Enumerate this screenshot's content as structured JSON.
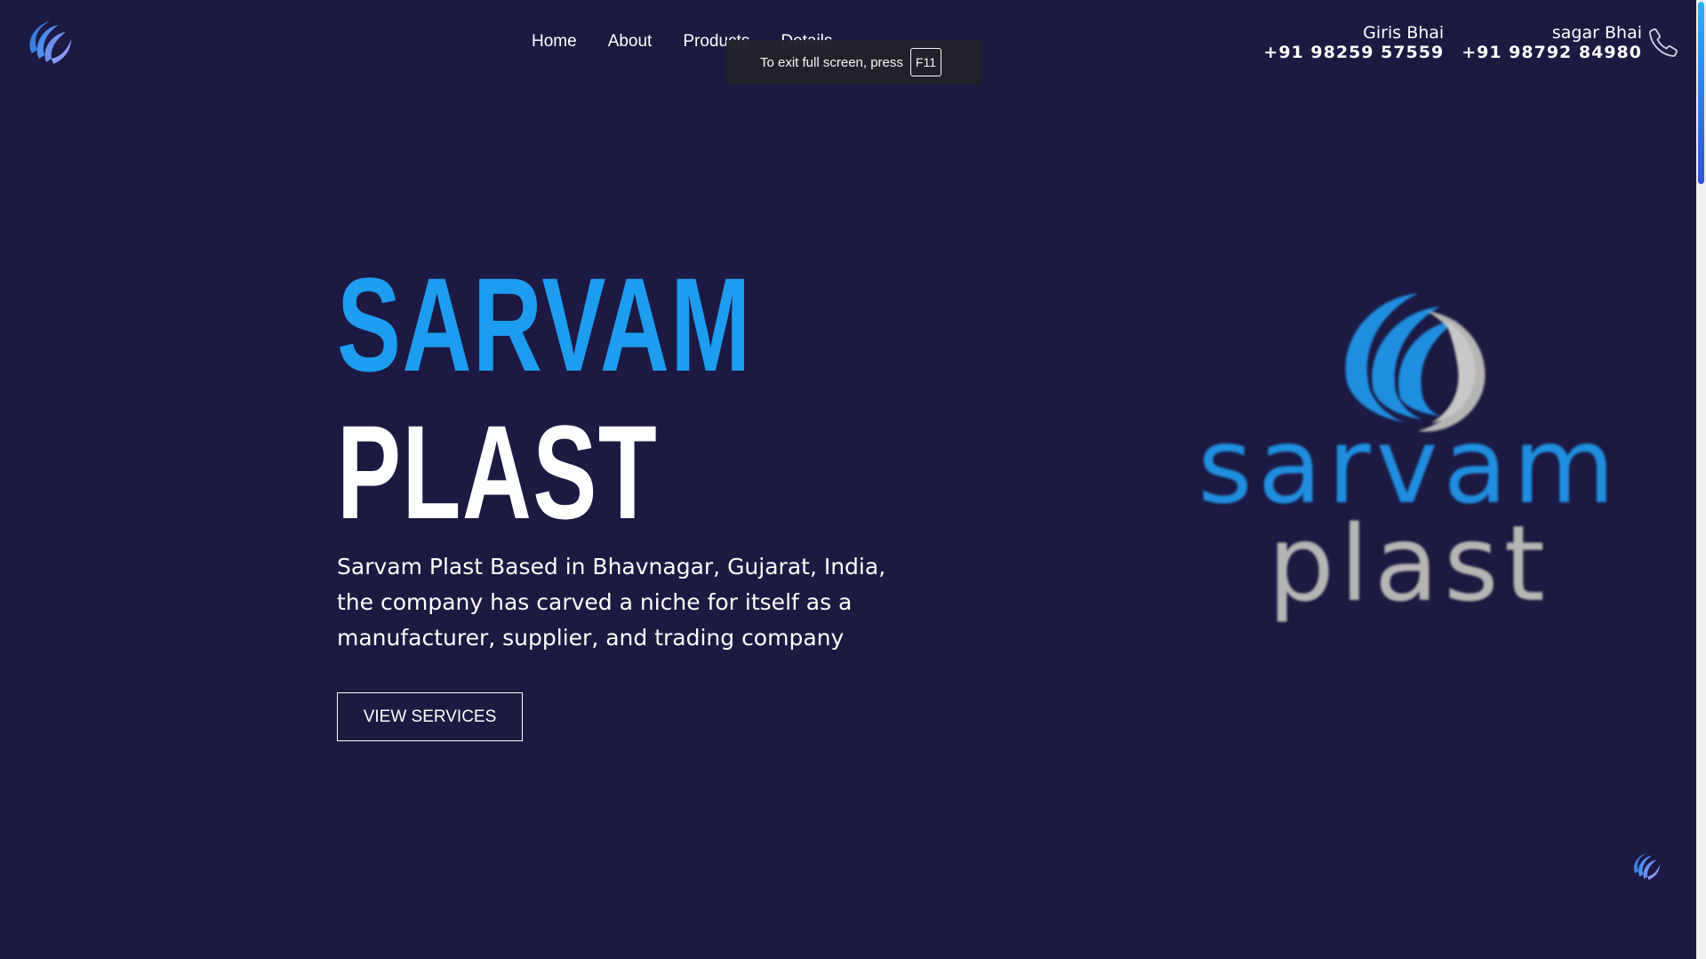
{
  "nav": {
    "items": [
      "Home",
      "About",
      "Products",
      "Details"
    ]
  },
  "contacts": [
    {
      "name": "Giris Bhai",
      "phone": "+91 98259 57559"
    },
    {
      "name": "sagar Bhai",
      "phone": "+91 98792 84980"
    }
  ],
  "fullscreen_notice": {
    "text": "To exit full screen, press",
    "key": "F11"
  },
  "hero": {
    "title_line1": "SARVAM",
    "title_line2": "PLAST",
    "description": "Sarvam Plast Based in Bhavnagar, Gujarat, India, the company has carved a niche for itself as a manufacturer, supplier, and trading company",
    "button_label": "VIEW SERVICES"
  },
  "brand_logo": {
    "word1": "sarvam",
    "word2": "plast"
  },
  "colors": {
    "background": "#1c1a42",
    "accent_blue": "#1e9cf0",
    "logo_gray": "#b7b4b4",
    "white": "#ffffff"
  },
  "icons": [
    "sarvam-swirl-logo-icon",
    "phone-icon"
  ]
}
